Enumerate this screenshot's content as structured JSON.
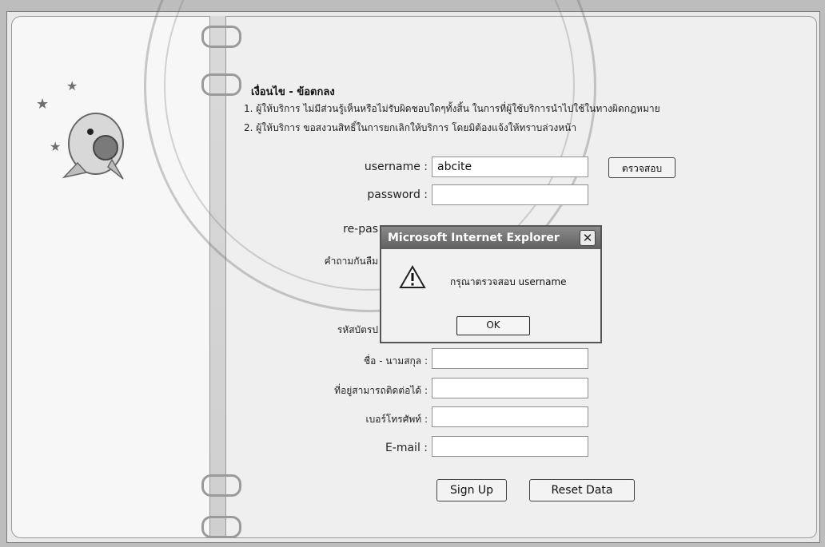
{
  "terms": {
    "title": "เงื่อนไข - ข้อตกลง",
    "line1": "1. ผู้ให้บริการ ไม่มีส่วนรู้เห็นหรือไม่รับผิดชอบใดๆทั้งสิ้น ในการที่ผู้ใช้บริการนำไปใช้ในทางผิดกฎหมาย",
    "line2": "2. ผู้ให้บริการ ขอสงวนสิทธิ์ในการยกเลิกให้บริการ โดยมิต้องแจ้งให้ทราบล่วงหน้า"
  },
  "form": {
    "username": {
      "label": "username :",
      "value": "abcite"
    },
    "check_button": "ตรวจสอบ",
    "password": {
      "label": "password :",
      "value": ""
    },
    "repassword": {
      "label": "re-pas",
      "value": ""
    },
    "hint_question": {
      "label": "คำถามกันลืม",
      "value": ""
    },
    "card_id": {
      "label": "รหัสบัตรป",
      "value": ""
    },
    "full_name": {
      "label": "ชื่อ - นามสกุล :",
      "value": ""
    },
    "address": {
      "label": "ที่อยู่สามารถติดต่อได้ :",
      "value": ""
    },
    "phone": {
      "label": "เบอร์โทรศัพท์ :",
      "value": ""
    },
    "email": {
      "label": "E-mail :",
      "value": ""
    },
    "signup_button": "Sign Up",
    "reset_button": "Reset Data"
  },
  "dialog": {
    "title": "Microsoft Internet Explorer",
    "close_glyph": "✕",
    "message": "กรุณาตรวจสอบ username",
    "ok_button": "OK"
  },
  "icons": {
    "warning": "warning-icon",
    "mascot": "mascot-icon",
    "star": "star-icon"
  },
  "colors": {
    "background": "#bdbdbd",
    "page": "#efefef",
    "dialog_title": "#6f6f6f"
  }
}
